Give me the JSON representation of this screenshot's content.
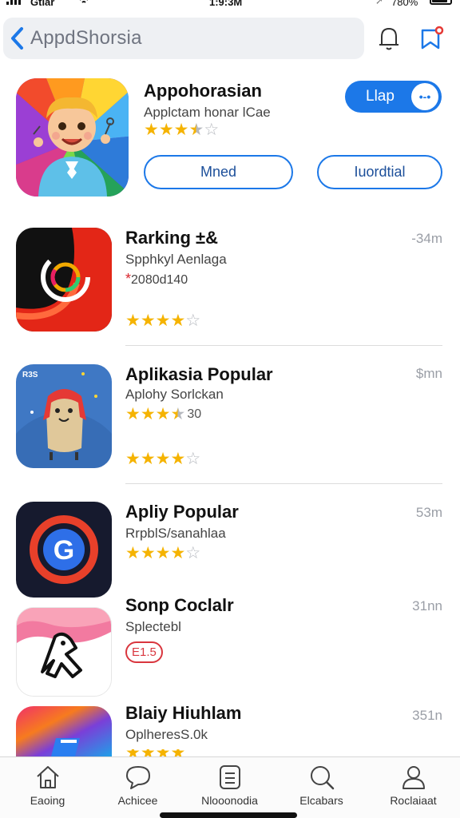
{
  "status_bar": {
    "carrier": "Gtiar",
    "time": "1:9:3M",
    "battery": "780%"
  },
  "header": {
    "search_text": "AppdShorsia",
    "icons": [
      "chevron-left-icon",
      "bell-icon",
      "bookmark-icon"
    ]
  },
  "featured": {
    "title": "Appohorasian",
    "subtitle": "Applctam honar lCae",
    "rating": 3.5,
    "get_label": "Llap",
    "get_knob": "•-•",
    "buttons": [
      "Mned",
      "Iuordtial"
    ]
  },
  "apps": [
    {
      "name": "Rarking ±&",
      "subtitle": "Spphkyl Aenlaga",
      "rank": "2080d140",
      "size": "-34m",
      "rating": 4
    },
    {
      "name": "Aplikasia Popular",
      "subtitle": "Aplohy Sorlckan",
      "rating_count": "30",
      "rating": 3.5,
      "rating_second": 4,
      "size": "$mn"
    },
    {
      "name": "Apliy Popular",
      "subtitle": "RrpblS/sanahlaa",
      "rating": 4,
      "size": "53m"
    },
    {
      "name": "Sonp Coclalr",
      "subtitle": "Splectebl",
      "badge": "E1.5",
      "size": "31nn"
    },
    {
      "name": "Blaiy Hiuhlam",
      "subtitle": "OplheresS.0k",
      "size": "351n"
    }
  ],
  "featured_art_text": "",
  "icon_badge_text": "R3S",
  "tabs": [
    {
      "label": "Eaoing",
      "icon": "home-icon"
    },
    {
      "label": "Achicee",
      "icon": "chat-icon"
    },
    {
      "label": "Nlooonodia",
      "icon": "list-icon"
    },
    {
      "label": "Elcabars",
      "icon": "search-icon"
    },
    {
      "label": "Roclaiaat",
      "icon": "profile-icon"
    }
  ],
  "colors": {
    "accent": "#1c78e8",
    "star": "#f5b301",
    "badge": "#d9363e"
  }
}
